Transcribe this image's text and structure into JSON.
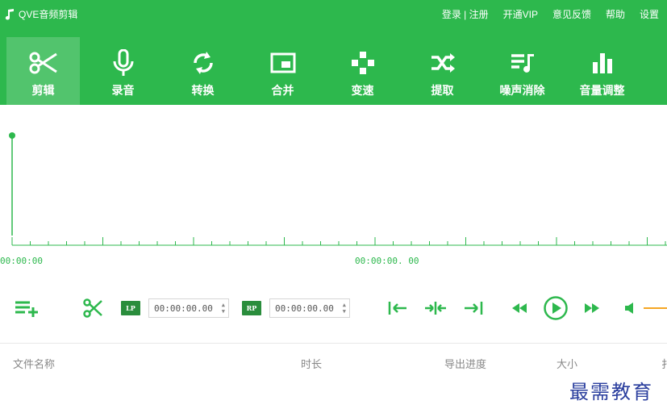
{
  "app": {
    "title": "QVE音频剪辑"
  },
  "top_links": [
    "登录 | 注册",
    "开通VIP",
    "意见反馈",
    "帮助",
    "设置"
  ],
  "tools": [
    {
      "label": "剪辑",
      "icon": "scissors-icon",
      "active": true
    },
    {
      "label": "录音",
      "icon": "microphone-icon"
    },
    {
      "label": "转换",
      "icon": "convert-icon"
    },
    {
      "label": "合并",
      "icon": "merge-icon"
    },
    {
      "label": "变速",
      "icon": "speed-icon"
    },
    {
      "label": "提取",
      "icon": "extract-icon"
    },
    {
      "label": "噪声消除",
      "icon": "noise-removal-icon"
    },
    {
      "label": "音量调整",
      "icon": "volume-bars-icon"
    }
  ],
  "timeline": {
    "start": "00:00:00",
    "mid": "00:00:00. 00"
  },
  "controls": {
    "lp_label": "LP",
    "lp_time": "00:00:00.00",
    "rp_label": "RP",
    "rp_time": "00:00:00.00"
  },
  "columns": {
    "name": "文件名称",
    "duration": "时长",
    "progress": "导出进度",
    "size": "大小",
    "extra": "扌"
  },
  "watermark": "最需教育",
  "colors": {
    "primary": "#2db84d",
    "badge": "#2a8d3c",
    "volume_slider": "#f5a623"
  }
}
